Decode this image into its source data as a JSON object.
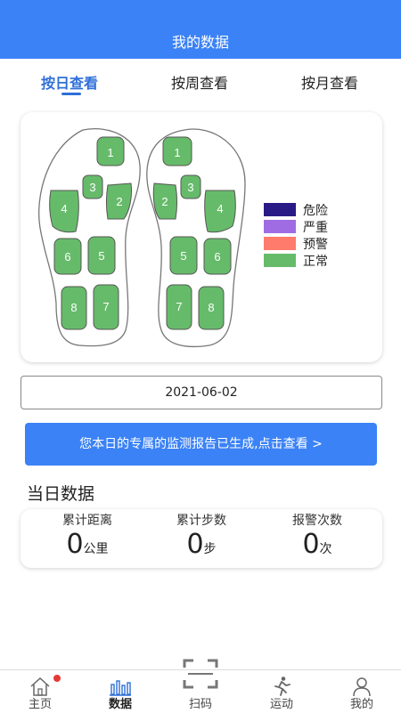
{
  "header": {
    "title": "我的数据"
  },
  "tabs": [
    {
      "label": "按日查看",
      "active": true
    },
    {
      "label": "按周查看",
      "active": false
    },
    {
      "label": "按月查看",
      "active": false
    }
  ],
  "zones": [
    "1",
    "2",
    "3",
    "4",
    "5",
    "6",
    "7",
    "8"
  ],
  "legend": [
    {
      "label": "危险",
      "color": "#2a1a86"
    },
    {
      "label": "严重",
      "color": "#a06ce4"
    },
    {
      "label": "预警",
      "color": "#ff7b6b"
    },
    {
      "label": "正常",
      "color": "#66bb6a"
    }
  ],
  "date": "2021-06-02",
  "report_button": "您本日的专属的监测报告已生成,点击查看   >",
  "section_title": "当日数据",
  "stats": [
    {
      "label": "累计距离",
      "value": "0",
      "unit": "公里"
    },
    {
      "label": "累计步数",
      "value": "0",
      "unit": "步"
    },
    {
      "label": "报警次数",
      "value": "0",
      "unit": "次"
    }
  ],
  "tabbar": [
    {
      "label": "主页",
      "icon": "home-icon"
    },
    {
      "label": "数据",
      "icon": "chart-icon"
    },
    {
      "label": "扫码",
      "icon": "scan-icon"
    },
    {
      "label": "运动",
      "icon": "run-icon"
    },
    {
      "label": "我的",
      "icon": "user-icon"
    }
  ]
}
